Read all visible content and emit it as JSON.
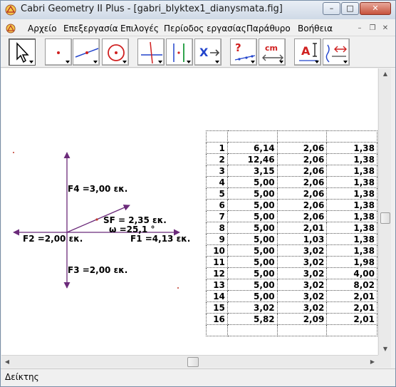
{
  "window": {
    "title": "Cabri Geometry II Plus - [gabri_blyktex1_dianysmata.fig]",
    "minimize": "–",
    "maximize": "□",
    "close": "✕"
  },
  "menu": {
    "items": [
      "Αρχείο",
      "Επεξεργασία",
      "Επιλογές",
      "Περίοδος εργασίας",
      "Παράθυρο",
      "Βοήθεια"
    ],
    "mdi_minimize": "–",
    "mdi_restore": "❐",
    "mdi_close": "✕"
  },
  "toolbar": {
    "tools": [
      {
        "name": "pointer-tool",
        "icon": "arrow-pointer-icon"
      },
      {
        "name": "point-tool",
        "icon": "point-icon"
      },
      {
        "name": "line-tool",
        "icon": "line-icon"
      },
      {
        "name": "circle-tool",
        "icon": "circle-icon"
      },
      {
        "name": "construct-perpendicular-tool",
        "icon": "perpendicular-icon"
      },
      {
        "name": "construct-parallel-tool",
        "icon": "parallel-icon"
      },
      {
        "name": "transform-tool",
        "icon": "transform-icon"
      },
      {
        "name": "check-property-tool",
        "icon": "question-icon"
      },
      {
        "name": "measure-tool",
        "icon": "measure-cm-icon"
      },
      {
        "name": "display-tool",
        "icon": "text-label-icon"
      },
      {
        "name": "draw-tool",
        "icon": "draw-icon"
      }
    ],
    "measure_label": "cm",
    "question_label": "?",
    "text_label": "A"
  },
  "figure": {
    "labels": {
      "f4": "F4 =3,00 εκ.",
      "sf": "SF = 2,35 εκ.",
      "omega": "ω =25,1 °",
      "f2": "F2 =2,00 εκ.",
      "f1": "F1 =4,13 εκ.",
      "f3": "F3 =2,00 εκ."
    },
    "vector_color": "#6b2a7a",
    "point_color": "#c0392b"
  },
  "table": {
    "rows": [
      [
        "",
        "",
        "",
        ""
      ],
      [
        "1",
        "6,14",
        "2,06",
        "1,38"
      ],
      [
        "2",
        "12,46",
        "2,06",
        "1,38"
      ],
      [
        "3",
        "3,15",
        "2,06",
        "1,38"
      ],
      [
        "4",
        "5,00",
        "2,06",
        "1,38"
      ],
      [
        "5",
        "5,00",
        "2,06",
        "1,38"
      ],
      [
        "6",
        "5,00",
        "2,06",
        "1,38"
      ],
      [
        "7",
        "5,00",
        "2,06",
        "1,38"
      ],
      [
        "8",
        "5,00",
        "2,01",
        "1,38"
      ],
      [
        "9",
        "5,00",
        "1,03",
        "1,38"
      ],
      [
        "10",
        "5,00",
        "3,02",
        "1,38"
      ],
      [
        "11",
        "5,00",
        "3,02",
        "1,98"
      ],
      [
        "12",
        "5,00",
        "3,02",
        "4,00"
      ],
      [
        "13",
        "5,00",
        "3,02",
        "8,02"
      ],
      [
        "14",
        "5,00",
        "3,02",
        "2,01"
      ],
      [
        "15",
        "3,02",
        "3,02",
        "2,01"
      ],
      [
        "16",
        "5,82",
        "2,09",
        "2,01"
      ],
      [
        "",
        "",
        "",
        ""
      ]
    ]
  },
  "status": {
    "text": "Δείκτης"
  }
}
